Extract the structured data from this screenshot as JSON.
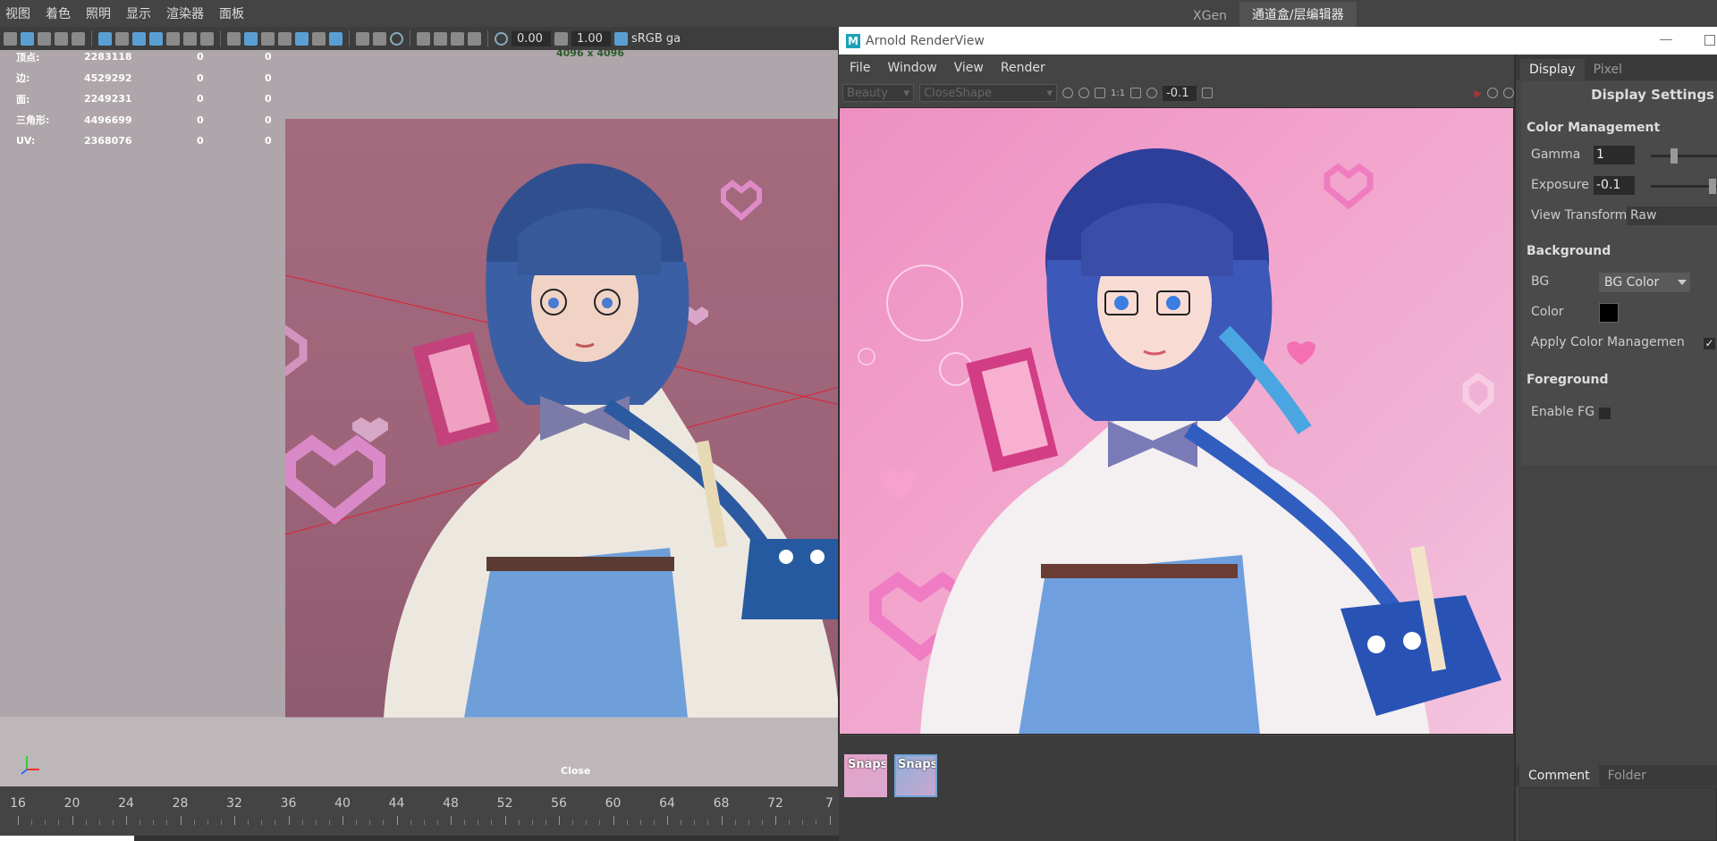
{
  "maya_menu": [
    "视图",
    "着色",
    "照明",
    "显示",
    "渲染器",
    "面板"
  ],
  "side_tabs": [
    "XGen",
    "通道盒/层编辑器"
  ],
  "toolbar": {
    "field1": "0.00",
    "field2": "1.00",
    "colorspace": "sRGB ga"
  },
  "hud": [
    {
      "k": "顶点:",
      "v": "2283118",
      "a": "0",
      "b": "0"
    },
    {
      "k": "边:",
      "v": "4529292",
      "a": "0",
      "b": "0"
    },
    {
      "k": "面:",
      "v": "2249231",
      "a": "0",
      "b": "0"
    },
    {
      "k": "三角形:",
      "v": "4496699",
      "a": "0",
      "b": "0"
    },
    {
      "k": "UV:",
      "v": "2368076",
      "a": "0",
      "b": "0"
    }
  ],
  "resolution": "4096 x 4096",
  "close_label": "Close",
  "timeline_ticks": [
    "16",
    "20",
    "24",
    "28",
    "32",
    "36",
    "40",
    "44",
    "48",
    "52",
    "56",
    "60",
    "64",
    "68",
    "72",
    "7"
  ],
  "arnold": {
    "title": "Arnold RenderView",
    "logo": "M",
    "menu": [
      "File",
      "Window",
      "View",
      "Render"
    ],
    "aov": "Beauty",
    "camera": "CloseShape",
    "exposure_field": "-0.1",
    "ratio": "1:1",
    "snapshot_label": "Snapsh"
  },
  "panel": {
    "tabs": [
      "Display",
      "Pixel"
    ],
    "title": "Display Settings",
    "color_mgmt": "Color Management",
    "gamma_label": "Gamma",
    "gamma": "1",
    "gamma_level": 0.3,
    "exposure_label": "Exposure",
    "exposure": "-0.1",
    "exposure_level": 0.9,
    "view_transform_label": "View Transform",
    "view_transform": "Raw",
    "background": "Background",
    "bg_label": "BG",
    "bg_value": "BG Color",
    "color_label": "Color",
    "apply_cm": "Apply Color Managemen",
    "apply_checked": "✓",
    "foreground": "Foreground",
    "enable_fg": "Enable FG",
    "bottom_tabs": [
      "Comment",
      "Folder"
    ]
  },
  "colors": {
    "accent": "#1aa3b8",
    "render_bg": "#ee8fc2",
    "viewport_bg": "#aea6aa"
  }
}
